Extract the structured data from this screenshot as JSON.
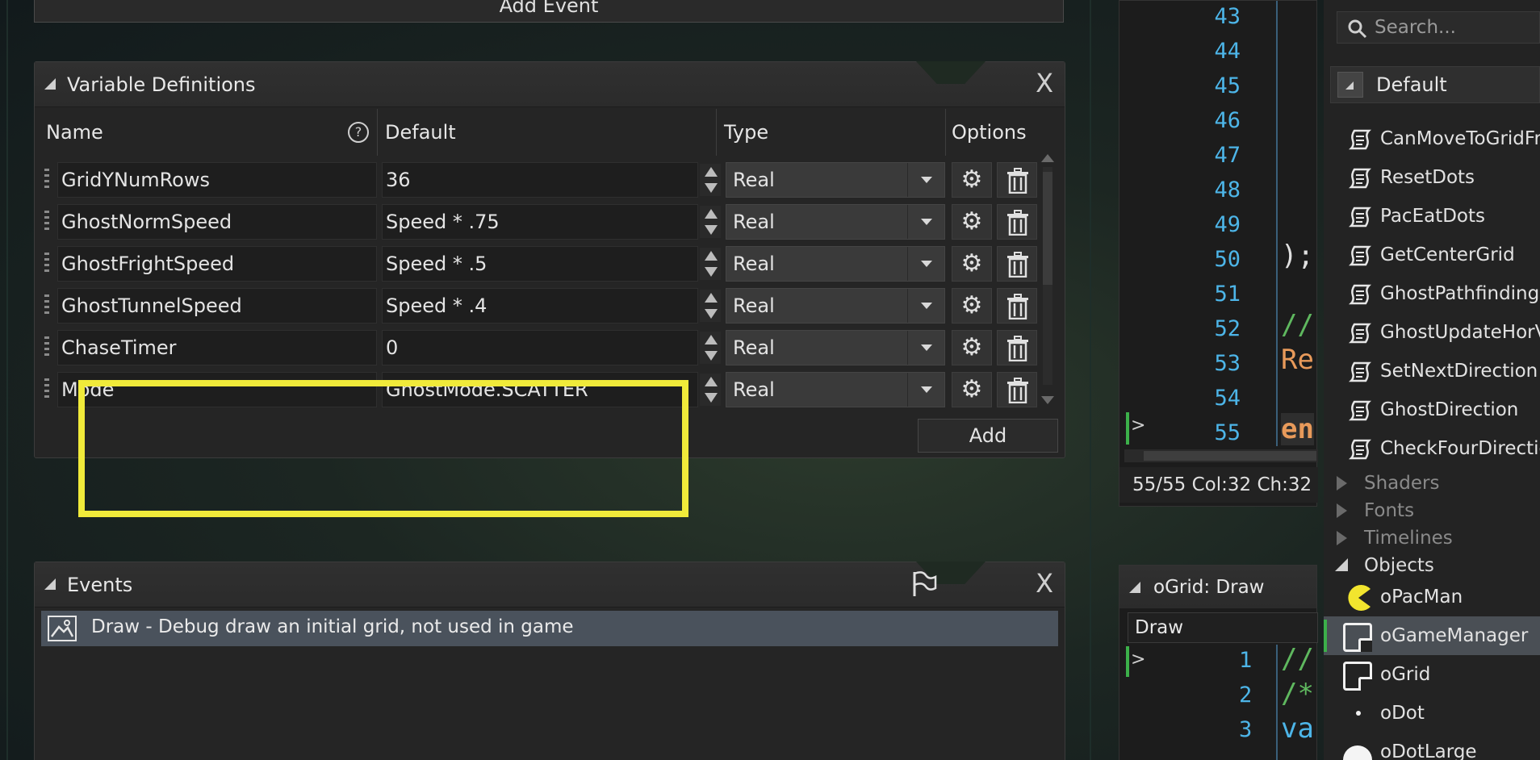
{
  "add_event": {
    "label": "Add Event"
  },
  "variable_definitions": {
    "title": "Variable Definitions",
    "columns": {
      "name": "Name",
      "default": "Default",
      "type": "Type",
      "options": "Options"
    },
    "rows": [
      {
        "name": "GridYNumRows",
        "default": "36",
        "type": "Real"
      },
      {
        "name": "GhostNormSpeed",
        "default": "Speed * .75",
        "type": "Real"
      },
      {
        "name": "GhostFrightSpeed",
        "default": "Speed * .5",
        "type": "Real"
      },
      {
        "name": "GhostTunnelSpeed",
        "default": "Speed * .4",
        "type": "Real"
      },
      {
        "name": "ChaseTimer",
        "default": "0",
        "type": "Real"
      },
      {
        "name": "Mode",
        "default": "GhostMode.SCATTER",
        "type": "Real"
      }
    ],
    "add_label": "Add",
    "close_glyph": "X",
    "help_glyph": "?"
  },
  "events": {
    "title": "Events",
    "close_glyph": "X",
    "items": [
      {
        "label": "Draw - Debug draw an initial grid, not used in game"
      }
    ]
  },
  "code_editor": {
    "line_numbers": [
      "43",
      "44",
      "45",
      "46",
      "47",
      "48",
      "49",
      "50",
      "51",
      "52",
      "53",
      "54",
      "55"
    ],
    "fragments": {
      "l50": ");",
      "l52": "//",
      "l53": "Re",
      "l55": "en"
    },
    "caret_glyph": ">",
    "status": "55/55 Col:32 Ch:32"
  },
  "draw_editor": {
    "title": "oGrid: Draw",
    "tab": "Draw",
    "line_numbers": [
      "1",
      "2",
      "3"
    ],
    "fragments": {
      "l1": "//",
      "l2": "/*",
      "l3": "va"
    },
    "caret_glyph": ">"
  },
  "asset_browser": {
    "search_placeholder": "Search...",
    "group": "Default",
    "scripts": [
      "CanMoveToGridFr",
      "ResetDots",
      "PacEatDots",
      "GetCenterGrid",
      "GhostPathfinding",
      "GhostUpdateHorV",
      "SetNextDirection",
      "GhostDirection",
      "CheckFourDirectio"
    ],
    "sections": [
      "Shaders",
      "Fonts",
      "Timelines"
    ],
    "objects_label": "Objects",
    "objects": [
      "oPacMan",
      "oGameManager",
      "oGrid",
      "oDot",
      "oDotLarge"
    ],
    "selected_object": "oGameManager"
  },
  "colors": {
    "highlight": "#f0ea3a",
    "line_number": "#4db5e8",
    "comment": "#5fb85f",
    "keyword_orange": "#e89a5a",
    "selection": "#4a525c"
  }
}
